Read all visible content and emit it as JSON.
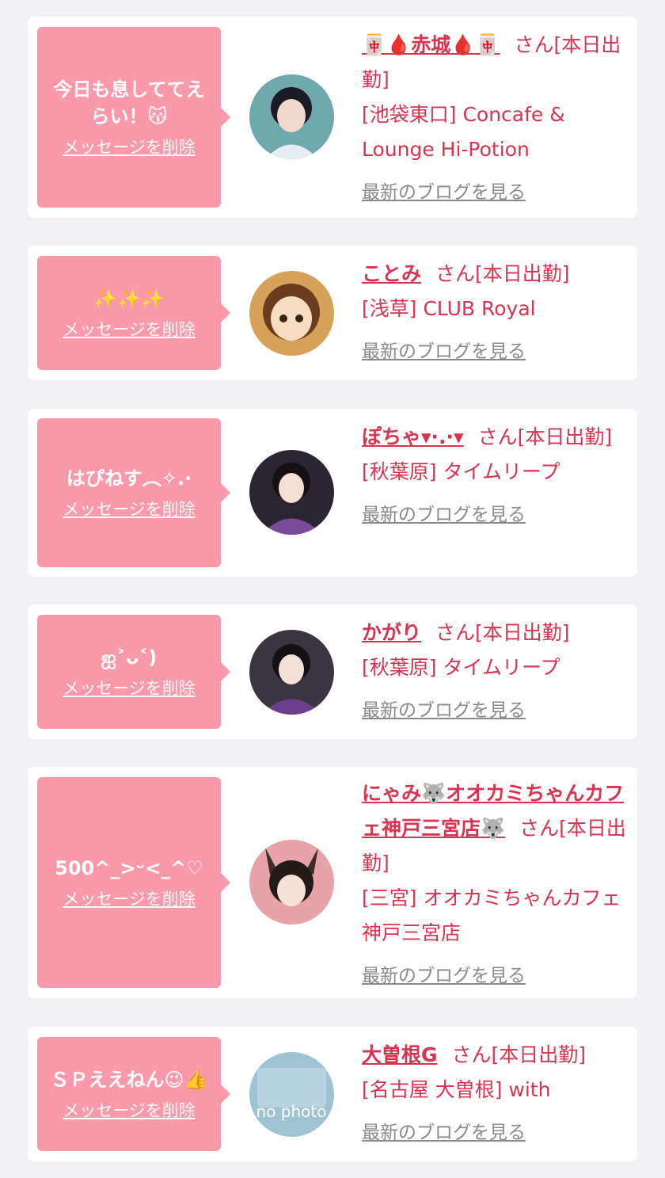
{
  "items": [
    {
      "message": "今日も息しててえらい！😽",
      "delete_label": "メッセージを削除",
      "name": "🀄🩸赤城🩸🀄",
      "status": "さん[本日出勤]",
      "shop": "[池袋東口] Concafe & Lounge Hi-Potion",
      "blog_label": "最新のブログを見る",
      "avatar_color": "#3e8a8f"
    },
    {
      "message": "✨✨✨",
      "delete_label": "メッセージを削除",
      "name": "ことみ",
      "status": "さん[本日出勤]",
      "shop": "[浅草] CLUB Royal",
      "blog_label": "最新のブログを見る",
      "avatar_color": "#c98a3e"
    },
    {
      "message": "はぴねす︵✧.·",
      "delete_label": "メッセージを削除",
      "name": "ぽちゃ▾·.·▾",
      "status": "さん[本日出勤]",
      "shop": "[秋葉原] タイムリープ",
      "blog_label": "最新のブログを見る",
      "avatar_color": "#5b3a6e"
    },
    {
      "message": "ஐ˃ᴗ˂)",
      "delete_label": "メッセージを削除",
      "name": "かがり",
      "status": "さん[本日出勤]",
      "shop": "[秋葉原] タイムリープ",
      "blog_label": "最新のブログを見る",
      "avatar_color": "#4a3f55"
    },
    {
      "message": "500^_>ᵕ<_^♡",
      "delete_label": "メッセージを削除",
      "name": "にゃみ🐺オオカミちゃんカフェ神戸三宮店🐺",
      "status": "さん[本日出勤]",
      "shop": "[三宮] オオカミちゃんカフェ神戸三宮店",
      "blog_label": "最新のブログを見る",
      "avatar_color": "#c9586e"
    },
    {
      "message": "ＳＰええねん😉👍",
      "delete_label": "メッセージを削除",
      "name": "大曽根G",
      "status": "さん[本日出勤]",
      "shop": "[名古屋 大曽根] with",
      "blog_label": "最新のブログを見る",
      "avatar_text": "no photo",
      "avatar_color": "#9ec3d3"
    }
  ]
}
